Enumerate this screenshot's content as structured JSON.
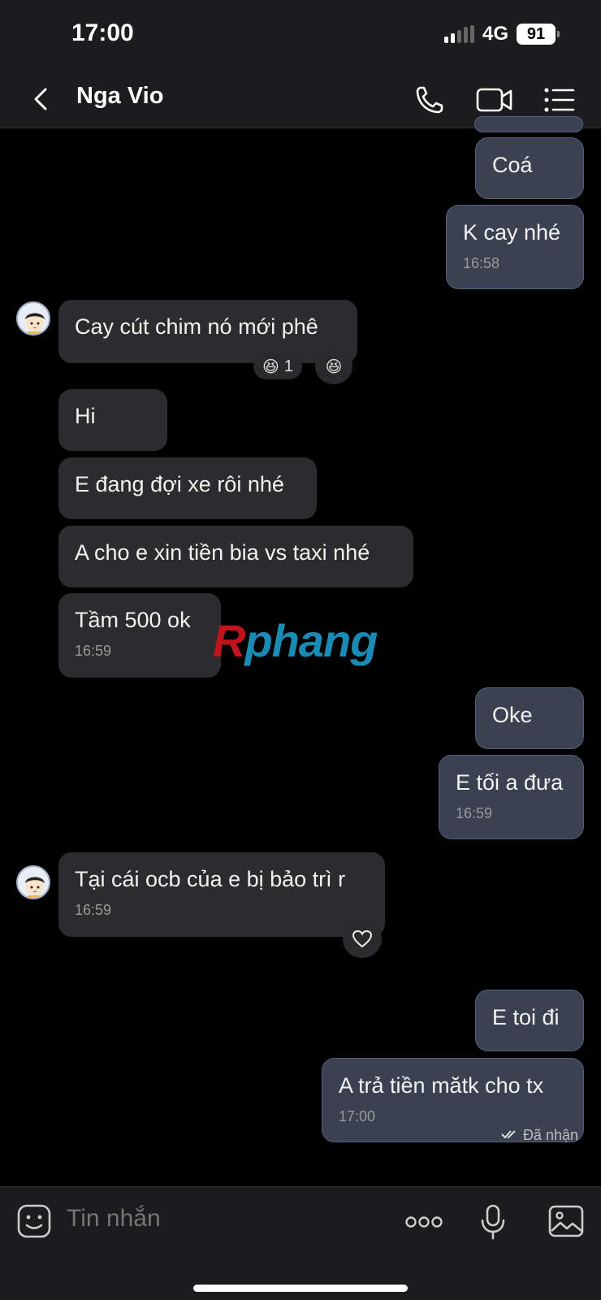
{
  "status_bar": {
    "time": "17:00",
    "network": "4G",
    "battery": "91"
  },
  "header": {
    "contact_name": "Nga Vio"
  },
  "messages": [
    {
      "text": "Coá"
    },
    {
      "text": "K cay nhé",
      "time": "16:58"
    },
    {
      "text": "Cay cút chim nó mới phê",
      "reaction_count": "1"
    },
    {
      "text": "Hi"
    },
    {
      "text": "E đang đợi xe rôi nhé"
    },
    {
      "text": "A cho e xin tiền bia vs taxi nhé"
    },
    {
      "text": "Tầm 500 ok",
      "time": "16:59"
    },
    {
      "text": "Oke"
    },
    {
      "text": "E tối a đưa",
      "time": "16:59"
    },
    {
      "text": "Tại cái ocb của e bị bảo trì r",
      "time": "16:59"
    },
    {
      "text": "E toi đi"
    },
    {
      "text": "A trả tiền mătk cho tx",
      "time": "17:00"
    }
  ],
  "watermark": {
    "first": "R",
    "rest": "phang"
  },
  "delivery_status": "Đã nhận",
  "input": {
    "placeholder": "Tin nhắn"
  },
  "colors": {
    "background": "#000000",
    "incoming_bubble": "#2c2c2e",
    "outgoing_bubble": "#3a4150",
    "bar": "#1c1c1e"
  }
}
